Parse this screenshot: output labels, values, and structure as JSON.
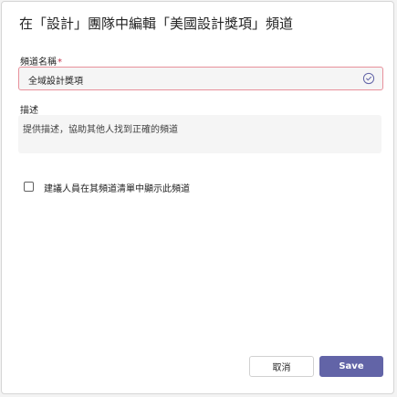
{
  "dialog": {
    "title": "在「設計」團隊中編輯「美國設計獎項」頻道"
  },
  "channel_name": {
    "label": "頻道名稱",
    "required_mark": "*",
    "value": "全域設計獎項",
    "status_icon": "check-circle-icon"
  },
  "description": {
    "label": "描述",
    "placeholder": "提供描述，協助其他人找到正確的頻道"
  },
  "show_channel": {
    "label": "建議人員在其頻道清單中顯示此頻道",
    "checked": false
  },
  "footer": {
    "cancel_label": "取消",
    "save_label": "Save"
  },
  "colors": {
    "accent": "#6264a7",
    "error_border": "#e8909b",
    "required": "#c4314b",
    "field_background": "#f5f5f5"
  }
}
